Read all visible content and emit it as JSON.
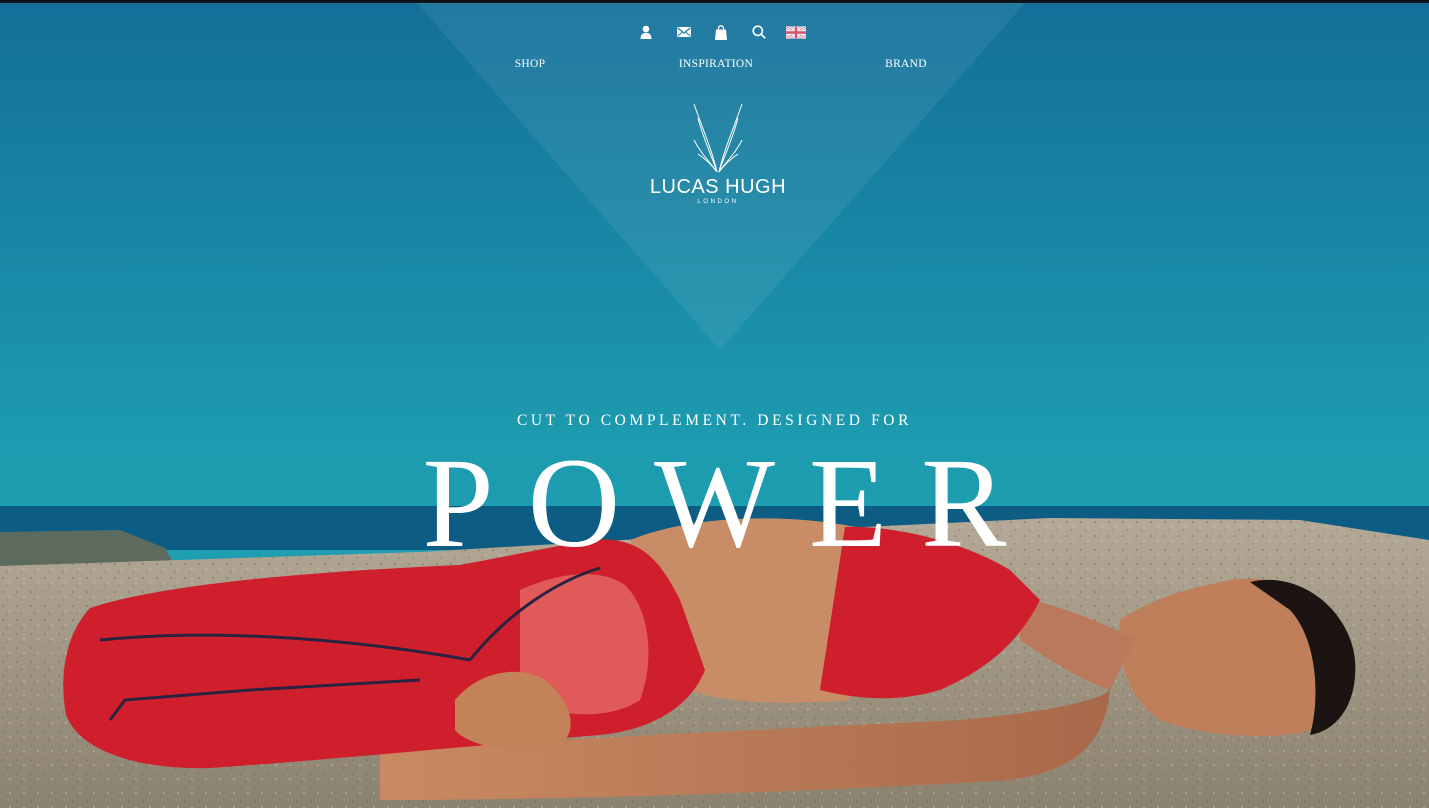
{
  "utility_nav": {
    "account_icon": "user-icon",
    "contact_icon": "mail-icon",
    "bag_icon": "shopping-bag-icon",
    "search_icon": "search-icon",
    "language_icon": "uk-flag-icon"
  },
  "main_nav": {
    "items": [
      {
        "label": "SHOP"
      },
      {
        "label": "INSPIRATION"
      },
      {
        "label": "BRAND"
      }
    ]
  },
  "logo": {
    "name": "LUCAS HUGH",
    "subtitle": "LONDON"
  },
  "hero": {
    "tagline": "CUT TO COMPLEMENT. DESIGNED FOR",
    "headline": "POWER"
  },
  "colors": {
    "sky_top": "#136f99",
    "sky_bottom": "#1fa3b1",
    "sea": "#0c5c84",
    "rock": "#a59a87",
    "outfit_red": "#cf1f2d",
    "text": "#ffffff"
  }
}
